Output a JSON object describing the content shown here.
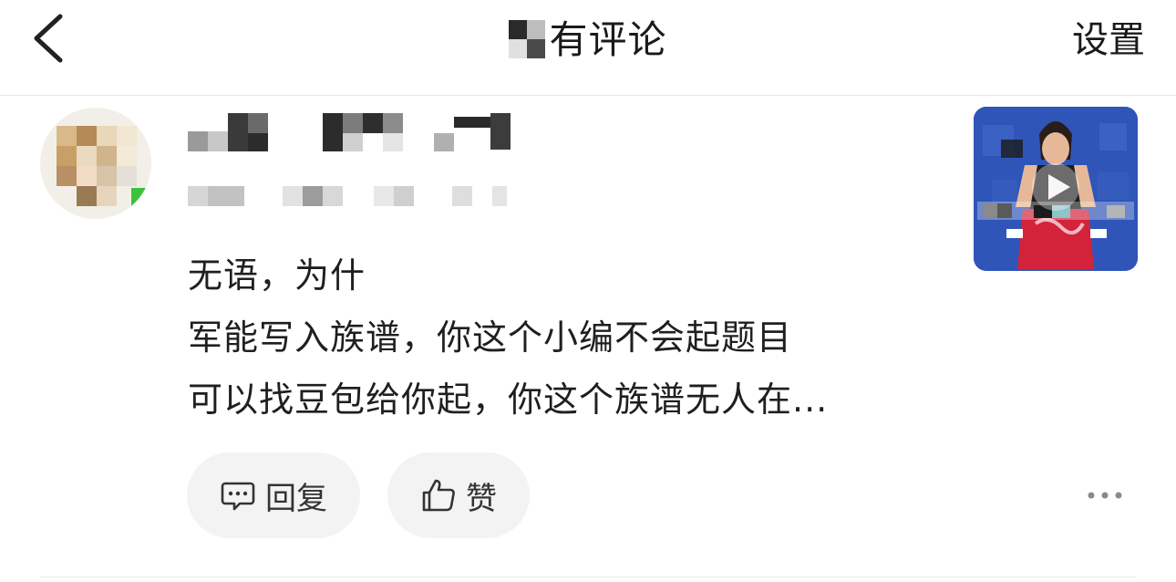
{
  "header": {
    "title": "有评论",
    "settings_label": "设置"
  },
  "comment": {
    "text_line1": "无语，为什",
    "text_line2": "军能写入族谱，你这个小编不会起题目",
    "text_line3": "可以找豆包给你起，你这个族谱无人在..."
  },
  "actions": {
    "reply_label": "回复",
    "like_label": "赞"
  },
  "icons": {
    "back": "chevron-left-icon",
    "reply": "chat-bubble-icon",
    "like": "thumbs-up-icon",
    "more": "more-dots-icon",
    "play": "play-icon"
  },
  "colors": {
    "pill_background": "#f3f3f3",
    "thumb_background": "#2f55b8",
    "text": "#1f1f1f"
  }
}
